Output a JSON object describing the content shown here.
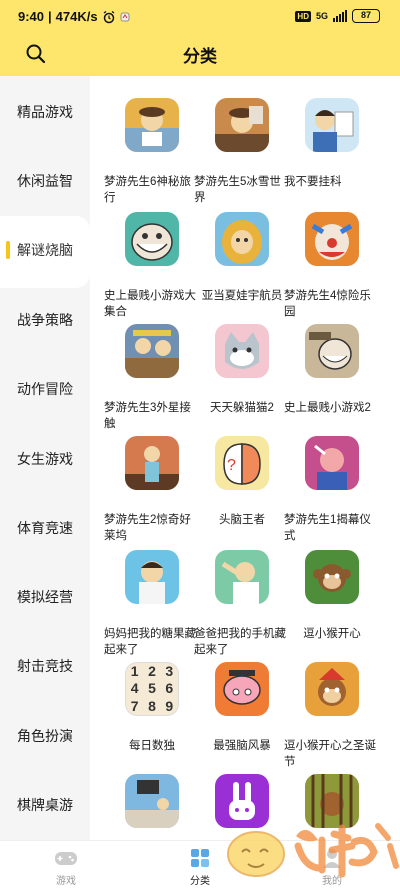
{
  "status": {
    "time": "9:40",
    "speed": "474K/s",
    "network": "5G",
    "battery": "87"
  },
  "header": {
    "title": "分类"
  },
  "sidebar": {
    "items": [
      {
        "label": "精品游戏"
      },
      {
        "label": "休闲益智"
      },
      {
        "label": "解谜烧脑",
        "active": true
      },
      {
        "label": "战争策略"
      },
      {
        "label": "动作冒险"
      },
      {
        "label": "女生游戏"
      },
      {
        "label": "体育竞速"
      },
      {
        "label": "模拟经营"
      },
      {
        "label": "射击竞技"
      },
      {
        "label": "角色扮演"
      },
      {
        "label": "棋牌桌游"
      }
    ]
  },
  "games": [
    {
      "name": "梦游先生6神秘旅行",
      "icon": "cartoon-man-icon",
      "color": "#E8B24A"
    },
    {
      "name": "梦游先生5冰雪世界",
      "icon": "cartoon-man-icon",
      "color": "#C98A4B"
    },
    {
      "name": "我不要挂科",
      "icon": "student-icon",
      "color": "#8FC7E8"
    },
    {
      "name": "史上最贱小游戏大集合",
      "icon": "troll-face-icon",
      "color": "#4FB6A8"
    },
    {
      "name": "亚当夏娃宇航员",
      "icon": "caveman-icon",
      "color": "#E9C04A"
    },
    {
      "name": "梦游先生4惊险乐园",
      "icon": "clown-icon",
      "color": "#E7872F"
    },
    {
      "name": "梦游先生3外星接触",
      "icon": "cartoon-scene-icon",
      "color": "#6F8FB3"
    },
    {
      "name": "天天躲猫猫2",
      "icon": "cat-icon",
      "color": "#F4C7D0"
    },
    {
      "name": "史上最贱小游戏2",
      "icon": "troll-face-icon",
      "color": "#C9B79A"
    },
    {
      "name": "梦游先生2惊奇好莱坞",
      "icon": "cartoon-man-icon",
      "color": "#D47A4E"
    },
    {
      "name": "头脑王者",
      "icon": "brain-icon",
      "color": "#F6E8A0"
    },
    {
      "name": "梦游先生1揭幕仪式",
      "icon": "cartoon-man-icon",
      "color": "#C54E8C"
    },
    {
      "name": "妈妈把我的糖果藏起来了",
      "icon": "boy-icon",
      "color": "#6CC3E6"
    },
    {
      "name": "爸爸把我的手机藏起来了",
      "icon": "boy-icon",
      "color": "#7CCBA6"
    },
    {
      "name": "逗小猴开心",
      "icon": "monkey-icon",
      "color": "#4E8E3A"
    },
    {
      "name": "每日数独",
      "icon": "sudoku-icon",
      "color": "#F5EAD6"
    },
    {
      "name": "最强脑风暴",
      "icon": "brain-icon",
      "color": "#F07B34"
    },
    {
      "name": "逗小猴开心之圣诞节",
      "icon": "monkey-icon",
      "color": "#E8A03A"
    },
    {
      "name": "",
      "icon": "room-icon",
      "color": "#7EB8E0"
    },
    {
      "name": "",
      "icon": "bunny-icon",
      "color": "#9A2FD6"
    },
    {
      "name": "",
      "icon": "monkey-icon",
      "color": "#8E9A3A"
    }
  ],
  "sudoku": [
    "1",
    "2",
    "3",
    "4",
    "5",
    "6",
    "7",
    "8",
    "9"
  ],
  "tabs": [
    {
      "label": "游戏",
      "icon": "gamepad-icon"
    },
    {
      "label": "分类",
      "icon": "category-grid-icon",
      "active": true
    },
    {
      "label": "我的",
      "icon": "profile-icon"
    }
  ],
  "accent": "#FDE66B"
}
